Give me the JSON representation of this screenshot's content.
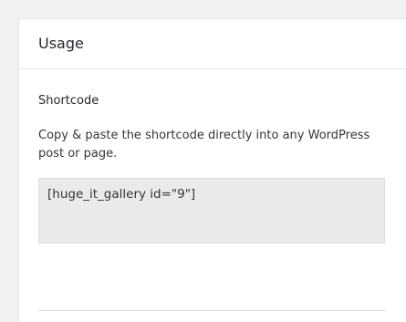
{
  "panel": {
    "title": "Usage",
    "shortcode_section": {
      "heading": "Shortcode",
      "description": "Copy & paste the shortcode directly into any WordPress post or page.",
      "shortcode_value": "[huge_it_gallery id=\"9\"]"
    }
  },
  "colors": {
    "page_background": "#f1f1f1",
    "panel_background": "#ffffff",
    "shortcode_background": "#eaeaea",
    "border": "#dddddd"
  }
}
